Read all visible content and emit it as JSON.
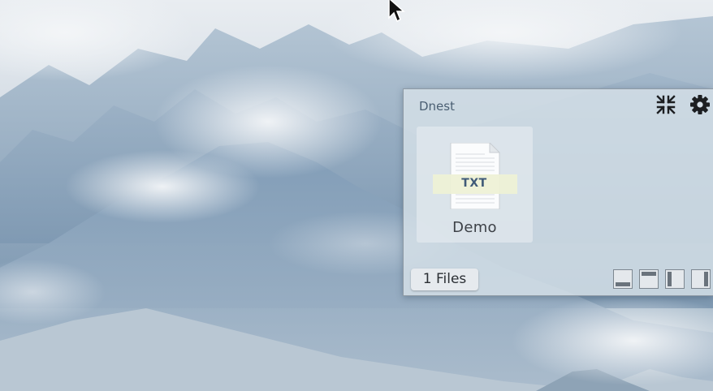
{
  "window": {
    "title": "Dnest"
  },
  "files": [
    {
      "name": "Demo",
      "type_label": "TXT",
      "icon": "txt-file-icon"
    }
  ],
  "status": {
    "count_label": "1 Files"
  },
  "toolbar": {
    "collapse_icon": "collapse-arrows-icon",
    "settings_icon": "gear-icon"
  },
  "dock_buttons": [
    {
      "id": "dock-bottom",
      "icon": "dock-bottom-icon"
    },
    {
      "id": "dock-top",
      "icon": "dock-top-icon"
    },
    {
      "id": "dock-left",
      "icon": "dock-left-icon"
    },
    {
      "id": "dock-right",
      "icon": "dock-right-icon"
    }
  ]
}
